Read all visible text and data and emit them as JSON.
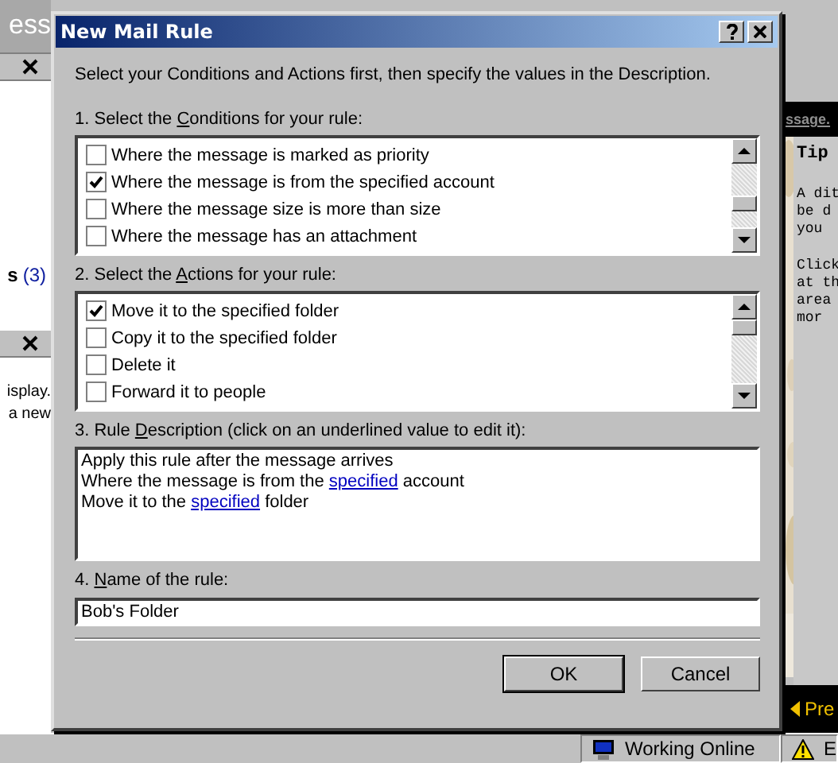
{
  "background_app": {
    "title_fragment": "ess",
    "left_pane": {
      "count_label": "s",
      "count": "(3)",
      "lines": [
        "isplay.",
        "a new"
      ]
    },
    "right_pane": {
      "header_fragment": "ssage.",
      "tip_title": "Tip",
      "tip_paragraphs": [
        [
          "A dit",
          "be d",
          "you"
        ],
        [
          "Click",
          "at th",
          "area",
          "mor"
        ]
      ],
      "nav_button": "Pre"
    },
    "status_bar": {
      "connection": "Working Online",
      "error_fragment": "E"
    }
  },
  "dialog": {
    "title": "New Mail Rule",
    "intro": "Select your Conditions and Actions first, then specify the values in the Description.",
    "conditions_label": {
      "before": "1. Select the ",
      "key": "C",
      "after": "onditions for your rule:"
    },
    "conditions": [
      {
        "label": "Where the message is marked as priority",
        "checked": false
      },
      {
        "label": "Where the message is from the specified account",
        "checked": true
      },
      {
        "label": "Where the message size is more than size",
        "checked": false
      },
      {
        "label": "Where the message has an attachment",
        "checked": false
      }
    ],
    "actions_label": {
      "before": "2. Select the ",
      "key": "A",
      "after": "ctions for your rule:"
    },
    "actions": [
      {
        "label": "Move it to the specified folder",
        "checked": true
      },
      {
        "label": "Copy it to the specified folder",
        "checked": false
      },
      {
        "label": "Delete it",
        "checked": false
      },
      {
        "label": "Forward it to people",
        "checked": false
      }
    ],
    "description_label": {
      "before": "3. Rule ",
      "key": "D",
      "after": "escription (click on an underlined value to edit it):"
    },
    "description_lines": [
      [
        {
          "kind": "text",
          "text": "Apply this rule after the message arrives"
        }
      ],
      [
        {
          "kind": "text",
          "text": "Where the message is from the "
        },
        {
          "kind": "link",
          "text": "specified"
        },
        {
          "kind": "text",
          "text": " account"
        }
      ],
      [
        {
          "kind": "text",
          "text": "Move it to the "
        },
        {
          "kind": "link",
          "text": "specified"
        },
        {
          "kind": "text",
          "text": " folder"
        }
      ]
    ],
    "name_label": {
      "before": "4. ",
      "key": "N",
      "after": "ame of the rule:"
    },
    "name_value": "Bob's Folder",
    "buttons": [
      "OK",
      "Cancel"
    ]
  }
}
